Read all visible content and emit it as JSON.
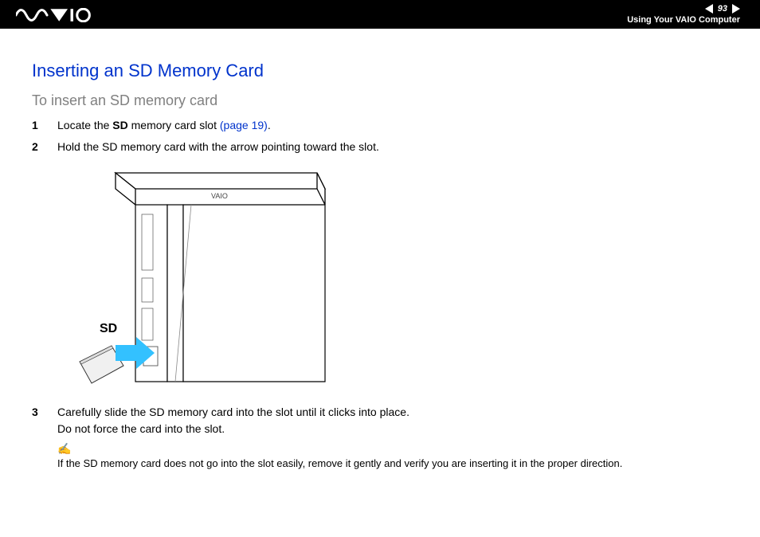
{
  "header": {
    "page_number": "93",
    "section": "Using Your VAIO Computer",
    "logo_text": "VAIO"
  },
  "content": {
    "title": "Inserting an SD Memory Card",
    "subtitle": "To insert an SD memory card",
    "steps": [
      {
        "num": "1",
        "text_before": "Locate the ",
        "bold": "SD",
        "text_mid": " memory card slot ",
        "link": "(page 19)",
        "text_after": "."
      },
      {
        "num": "2",
        "text": "Hold the SD memory card with the arrow pointing toward the slot."
      },
      {
        "num": "3",
        "line1": "Carefully slide the SD memory card into the slot until it clicks into place.",
        "line2": "Do not force the card into the slot."
      }
    ],
    "figure": {
      "label": "SD",
      "logo_small": "VAIO"
    },
    "note": "If the SD memory card does not go into the slot easily, remove it gently and verify you are inserting it in the proper direction."
  }
}
